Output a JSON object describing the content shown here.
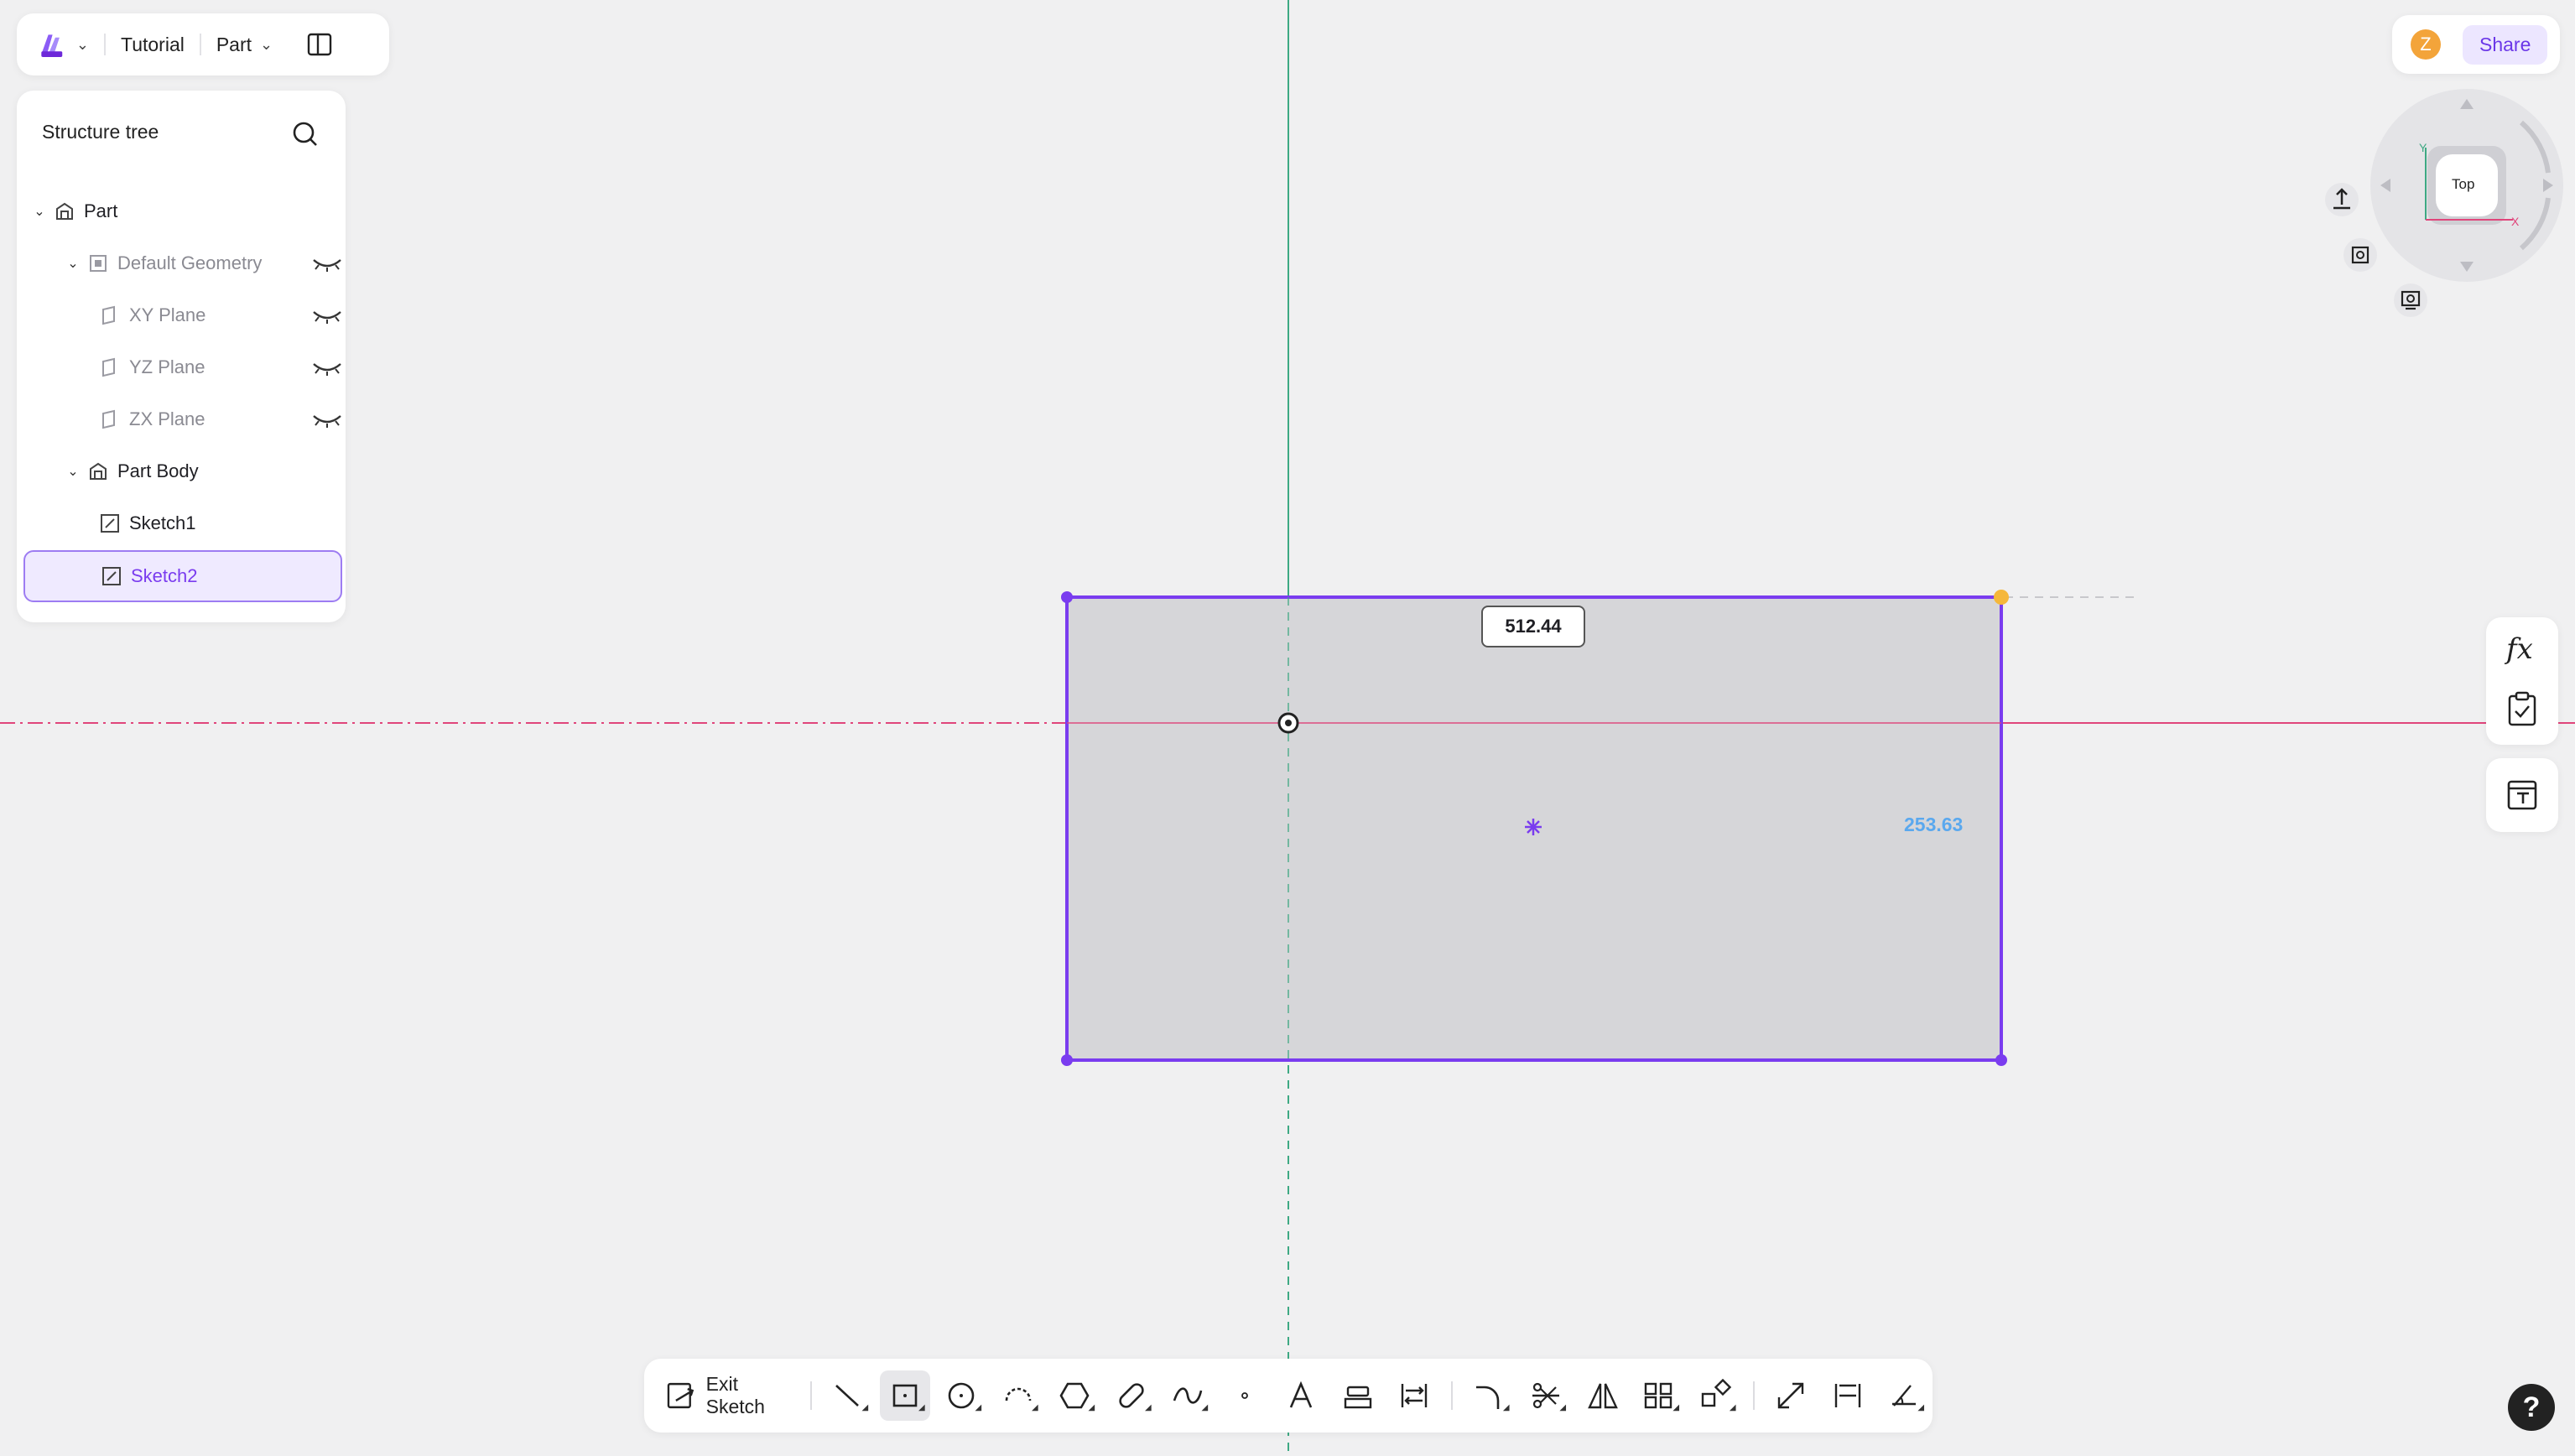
{
  "topbar": {
    "project": "Tutorial",
    "mode": "Part"
  },
  "tree": {
    "title": "Structure tree",
    "items": [
      {
        "label": "Part"
      },
      {
        "label": "Default Geometry"
      },
      {
        "label": "XY Plane"
      },
      {
        "label": "YZ Plane"
      },
      {
        "label": "ZX Plane"
      },
      {
        "label": "Part Body"
      },
      {
        "label": "Sketch1"
      },
      {
        "label": "Sketch2"
      }
    ]
  },
  "user": {
    "avatar_letter": "Z"
  },
  "share_label": "Share",
  "viewcube": {
    "face": "Top",
    "axis_x": "X",
    "axis_y": "Y"
  },
  "sketch": {
    "width_dim": "512.44",
    "height_dim": "253.63"
  },
  "toolbar": {
    "exit_label": "Exit Sketch"
  },
  "side": {
    "fx_label": "fx"
  },
  "help_label": "?",
  "colors": {
    "accent": "#7a3cef",
    "axis_red": "#e0457b",
    "axis_green": "#3ea983",
    "sketch_fill": "#d3d3d6"
  }
}
